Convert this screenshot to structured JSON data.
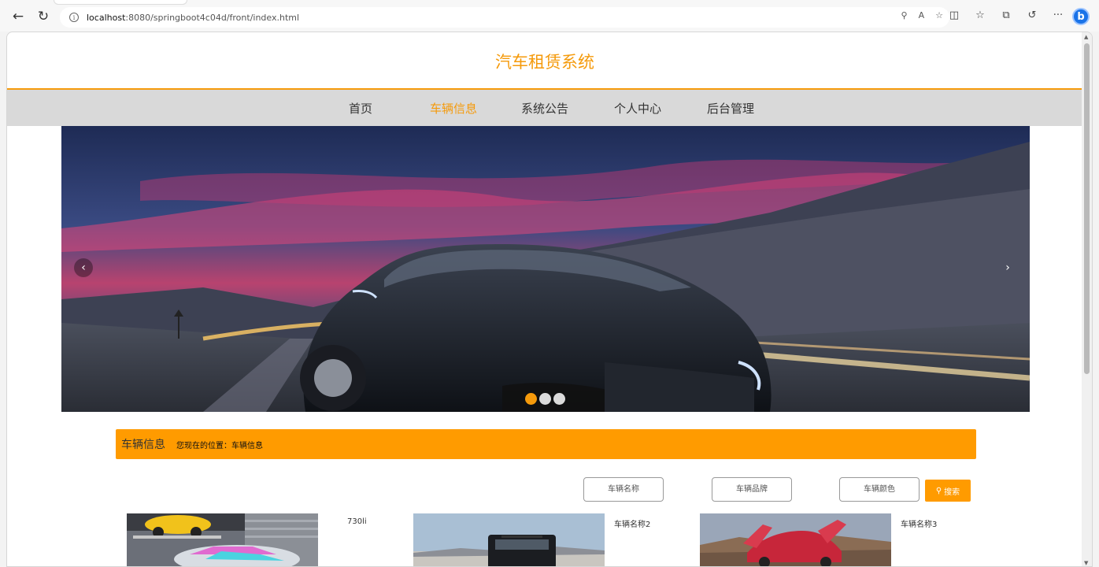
{
  "browser": {
    "url_host": "localhost",
    "url_path": ":8080/springboot4c04d/front/index.html",
    "more_label": "···"
  },
  "site": {
    "title": "汽车租赁系统"
  },
  "nav": {
    "items": [
      "首页",
      "车辆信息",
      "系统公告",
      "个人中心",
      "后台管理"
    ],
    "active_index": 1
  },
  "banner": {
    "slide_count": 3,
    "active_slide": 0
  },
  "breadcrumb": {
    "title": "车辆信息",
    "location": "您现在的位置：车辆信息"
  },
  "search": {
    "name_placeholder": "车辆名称",
    "brand_placeholder": "车辆品牌",
    "color_placeholder": "车辆颜色",
    "button_label": "搜索"
  },
  "cars": [
    {
      "name": "730li"
    },
    {
      "name": "车辆名称2"
    },
    {
      "name": "车辆名称3"
    }
  ],
  "colors": {
    "accent": "#f59a0b",
    "breadcrumb_bg": "#ff9b00",
    "nav_bg": "#d9d9d9"
  }
}
